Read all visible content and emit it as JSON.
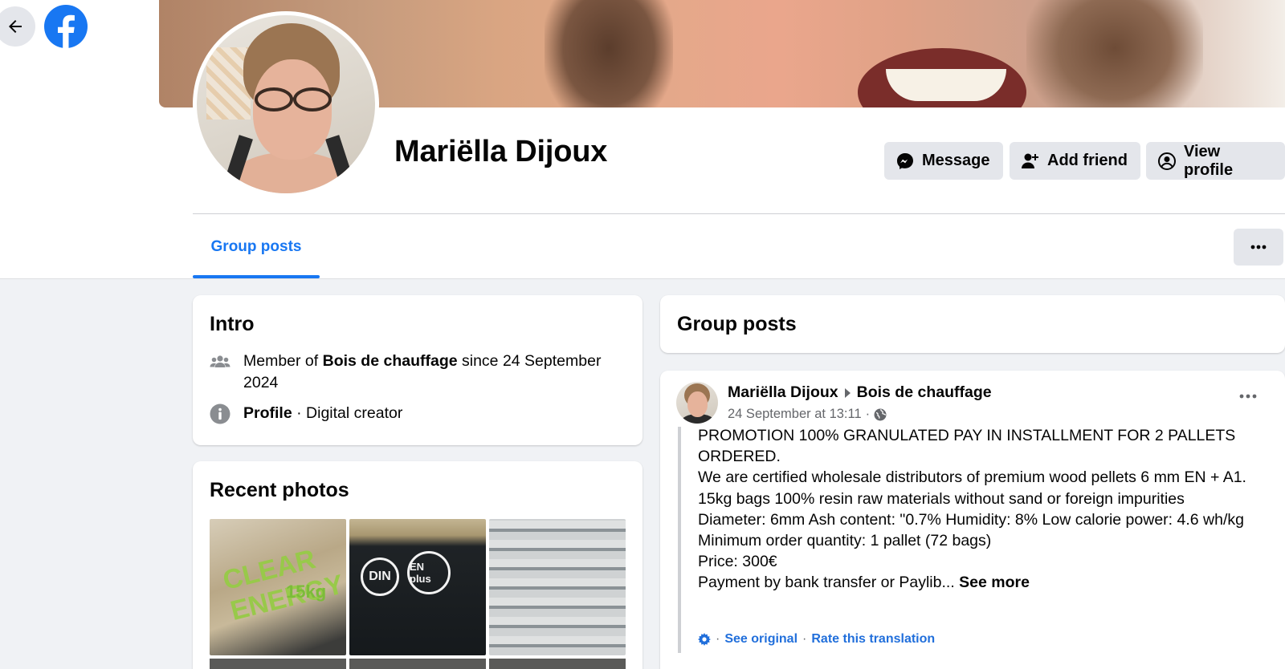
{
  "nav": {
    "back_icon": "arrow-left-icon",
    "logo_icon": "facebook-logo-icon",
    "brand_color": "#1877f2"
  },
  "profile": {
    "name": "Mariëlla Dijoux",
    "actions": {
      "message_label": "Message",
      "add_friend_label": "Add friend",
      "view_profile_label": "View profile"
    }
  },
  "tabs": {
    "active_label": "Group posts",
    "more_icon": "more-horizontal-icon"
  },
  "intro": {
    "title": "Intro",
    "membership": {
      "prefix": "Member of",
      "group": "Bois de chauffage",
      "suffix": "since 24 September 2024"
    },
    "profile_row": {
      "label": "Profile",
      "separator": "·",
      "category": "Digital creator"
    }
  },
  "photos": {
    "title": "Recent photos",
    "photo1_text": "CLEAR ENERGY",
    "photo1_kg": "15kg",
    "photo2_logo1": "DIN",
    "photo2_logo2": "EN plus"
  },
  "group_posts": {
    "title": "Group posts"
  },
  "post": {
    "author": "Mariëlla Dijoux",
    "group": "Bois de chauffage",
    "timestamp": "24 September at 13:11",
    "meta_separator": "·",
    "body_lines": [
      "PROMOTION 100% GRANULATED PAY IN INSTALLMENT FOR 2 PALLETS ORDERED.",
      "We are certified wholesale distributors of premium wood pellets 6 mm EN + A1. 15kg bags 100% resin raw materials without sand or foreign impurities",
      "Diameter: 6mm Ash content: \"0.7% Humidity: 8% Low calorie power: 4.6 wh/kg",
      "Minimum order quantity: 1 pallet (72 bags)",
      "Price: 300€",
      "Payment by bank transfer or Paylib..."
    ],
    "see_more": "See more",
    "translate": {
      "see_original": "See original",
      "rate": "Rate this translation",
      "separator": "·"
    }
  }
}
